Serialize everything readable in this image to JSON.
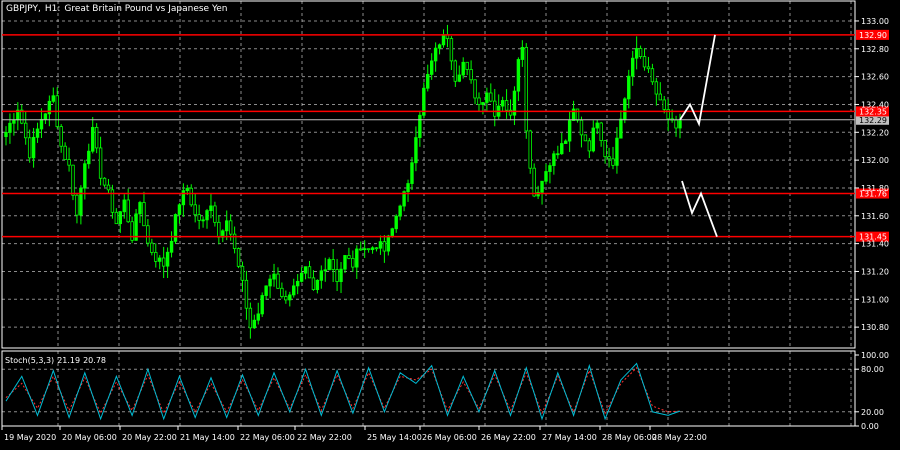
{
  "header": {
    "symbol": "GBPJPY,",
    "timeframe": "H1:",
    "description": "Great Britain Pound vs Japanese Yen"
  },
  "colors": {
    "background": "#000000",
    "bull_candle": "#00ff00",
    "bear_candle": "#000000",
    "candle_outline": "#00ff00",
    "grid": "#ffffff",
    "level_line": "#ff0000",
    "level_label_bg": "#ff0000",
    "current_price_line": "#c0c0c0",
    "projection": "#ffffff",
    "stoch_main": "#00bcd4",
    "stoch_signal": "#ff3030"
  },
  "price_axis": {
    "ticks": [
      "133.00",
      "132.80",
      "132.60",
      "132.40",
      "132.20",
      "132.00",
      "131.80",
      "131.60",
      "131.40",
      "131.20",
      "131.00",
      "130.80"
    ]
  },
  "levels": [
    {
      "value": 132.9,
      "label": "132.90"
    },
    {
      "value": 132.35,
      "label": "132.35"
    },
    {
      "value": 131.76,
      "label": "131.76"
    },
    {
      "value": 131.45,
      "label": "131.45"
    }
  ],
  "current_price": {
    "value": 132.29,
    "label": "132.29"
  },
  "stoch_panel": {
    "title": "Stoch(5,3,3)",
    "main_value": "21.19",
    "signal_value": "20.78",
    "ticks": [
      "100.00",
      "80.00",
      "20.00",
      "0.00"
    ]
  },
  "time_axis": {
    "labels": [
      "19 May 2020",
      "20 May 06:00",
      "20 May 22:00",
      "21 May 14:00",
      "22 May 06:00",
      "22 May 22:00",
      "25 May 14:00",
      "26 May 06:00",
      "26 May 22:00",
      "27 May 14:00",
      "28 May 06:00",
      "28 May 22:00"
    ]
  },
  "chart_data": {
    "type": "candlestick",
    "title": "GBPJPY, H1: Great Britain Pound vs Japanese Yen",
    "ylim": [
      130.65,
      133.05
    ],
    "anchors": [
      [
        0,
        132.2
      ],
      [
        3,
        132.38
      ],
      [
        6,
        132.05
      ],
      [
        9,
        132.3
      ],
      [
        12,
        132.45
      ],
      [
        14,
        132.1
      ],
      [
        16,
        131.95
      ],
      [
        18,
        131.6
      ],
      [
        20,
        132.0
      ],
      [
        22,
        132.2
      ],
      [
        24,
        131.9
      ],
      [
        26,
        131.75
      ],
      [
        28,
        131.55
      ],
      [
        30,
        131.7
      ],
      [
        32,
        131.45
      ],
      [
        34,
        131.7
      ],
      [
        36,
        131.4
      ],
      [
        38,
        131.3
      ],
      [
        40,
        131.25
      ],
      [
        42,
        131.45
      ],
      [
        44,
        131.7
      ],
      [
        46,
        131.8
      ],
      [
        48,
        131.6
      ],
      [
        50,
        131.55
      ],
      [
        52,
        131.7
      ],
      [
        54,
        131.45
      ],
      [
        56,
        131.6
      ],
      [
        58,
        131.35
      ],
      [
        60,
        131.1
      ],
      [
        62,
        130.8
      ],
      [
        64,
        130.9
      ],
      [
        66,
        131.1
      ],
      [
        68,
        131.2
      ],
      [
        70,
        131.0
      ],
      [
        72,
        131.05
      ],
      [
        74,
        131.1
      ],
      [
        76,
        131.2
      ],
      [
        78,
        131.05
      ],
      [
        80,
        131.2
      ],
      [
        82,
        131.3
      ],
      [
        84,
        131.15
      ],
      [
        86,
        131.3
      ],
      [
        88,
        131.25
      ],
      [
        90,
        131.4
      ],
      [
        92,
        131.35
      ],
      [
        94,
        131.4
      ],
      [
        96,
        131.35
      ],
      [
        98,
        131.5
      ],
      [
        100,
        131.7
      ],
      [
        102,
        131.8
      ],
      [
        104,
        132.2
      ],
      [
        106,
        132.5
      ],
      [
        108,
        132.7
      ],
      [
        110,
        132.85
      ],
      [
        112,
        132.9
      ],
      [
        114,
        132.6
      ],
      [
        116,
        132.7
      ],
      [
        118,
        132.55
      ],
      [
        120,
        132.4
      ],
      [
        122,
        132.5
      ],
      [
        124,
        132.35
      ],
      [
        126,
        132.45
      ],
      [
        128,
        132.3
      ],
      [
        130,
        132.75
      ],
      [
        131,
        132.85
      ],
      [
        132,
        132.2
      ],
      [
        134,
        131.75
      ],
      [
        136,
        131.85
      ],
      [
        138,
        132.0
      ],
      [
        140,
        132.05
      ],
      [
        142,
        132.15
      ],
      [
        144,
        132.35
      ],
      [
        146,
        132.2
      ],
      [
        148,
        132.1
      ],
      [
        150,
        132.3
      ],
      [
        152,
        132.05
      ],
      [
        154,
        132.0
      ],
      [
        156,
        132.3
      ],
      [
        158,
        132.6
      ],
      [
        160,
        132.8
      ],
      [
        162,
        132.7
      ],
      [
        164,
        132.55
      ],
      [
        166,
        132.4
      ],
      [
        168,
        132.3
      ],
      [
        170,
        132.2
      ],
      [
        171,
        132.29
      ]
    ],
    "projection": [
      [
        132.29,
        0
      ],
      [
        132.4,
        1
      ],
      [
        132.26,
        2
      ],
      [
        132.9,
        3
      ]
    ],
    "projection_low": [
      [
        131.85,
        0
      ],
      [
        131.62,
        1
      ],
      [
        131.76,
        2
      ],
      [
        131.45,
        3
      ]
    ],
    "stoch_main": [
      [
        0,
        35
      ],
      [
        4,
        70
      ],
      [
        8,
        15
      ],
      [
        12,
        78
      ],
      [
        16,
        12
      ],
      [
        20,
        75
      ],
      [
        24,
        10
      ],
      [
        28,
        70
      ],
      [
        32,
        15
      ],
      [
        36,
        80
      ],
      [
        40,
        10
      ],
      [
        44,
        70
      ],
      [
        48,
        12
      ],
      [
        52,
        68
      ],
      [
        56,
        12
      ],
      [
        60,
        72
      ],
      [
        64,
        15
      ],
      [
        68,
        75
      ],
      [
        72,
        20
      ],
      [
        76,
        80
      ],
      [
        80,
        15
      ],
      [
        84,
        78
      ],
      [
        88,
        18
      ],
      [
        92,
        82
      ],
      [
        96,
        20
      ],
      [
        100,
        75
      ],
      [
        104,
        60
      ],
      [
        108,
        85
      ],
      [
        112,
        15
      ],
      [
        116,
        70
      ],
      [
        120,
        20
      ],
      [
        124,
        78
      ],
      [
        128,
        15
      ],
      [
        132,
        82
      ],
      [
        136,
        10
      ],
      [
        140,
        75
      ],
      [
        144,
        15
      ],
      [
        148,
        85
      ],
      [
        152,
        10
      ],
      [
        156,
        65
      ],
      [
        160,
        88
      ],
      [
        164,
        20
      ],
      [
        168,
        15
      ],
      [
        171,
        21
      ]
    ],
    "stoch_signal": [
      [
        0,
        40
      ],
      [
        4,
        60
      ],
      [
        8,
        25
      ],
      [
        12,
        70
      ],
      [
        16,
        22
      ],
      [
        20,
        68
      ],
      [
        24,
        18
      ],
      [
        28,
        62
      ],
      [
        32,
        22
      ],
      [
        36,
        72
      ],
      [
        40,
        18
      ],
      [
        44,
        62
      ],
      [
        48,
        20
      ],
      [
        52,
        60
      ],
      [
        56,
        20
      ],
      [
        60,
        65
      ],
      [
        64,
        22
      ],
      [
        68,
        68
      ],
      [
        72,
        25
      ],
      [
        76,
        72
      ],
      [
        80,
        22
      ],
      [
        84,
        72
      ],
      [
        88,
        25
      ],
      [
        92,
        75
      ],
      [
        96,
        25
      ],
      [
        100,
        70
      ],
      [
        104,
        65
      ],
      [
        108,
        80
      ],
      [
        112,
        22
      ],
      [
        116,
        62
      ],
      [
        120,
        25
      ],
      [
        124,
        72
      ],
      [
        128,
        22
      ],
      [
        132,
        75
      ],
      [
        136,
        18
      ],
      [
        140,
        70
      ],
      [
        144,
        20
      ],
      [
        148,
        78
      ],
      [
        152,
        18
      ],
      [
        156,
        60
      ],
      [
        160,
        82
      ],
      [
        164,
        28
      ],
      [
        168,
        20
      ],
      [
        171,
        21
      ]
    ]
  }
}
